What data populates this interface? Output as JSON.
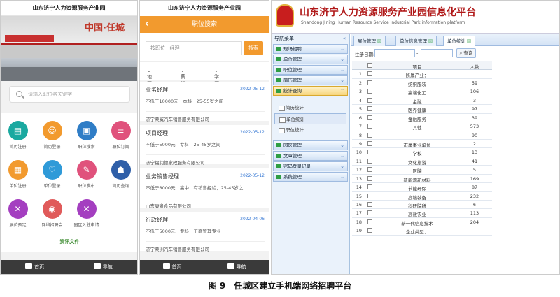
{
  "phone1": {
    "title": "山东济宁人力资源服务产业园",
    "banner_text": "中国·任城",
    "search_placeholder": "请输入职位名关键字",
    "grid": [
      {
        "label": "简历注册",
        "icon": "resume-register-icon",
        "color": "#1aa9a0"
      },
      {
        "label": "简历登录",
        "icon": "resume-login-icon",
        "color": "#f29a2e"
      },
      {
        "label": "职位搜索",
        "icon": "job-search-icon",
        "color": "#2f7dc6"
      },
      {
        "label": "职位订阅",
        "icon": "job-subscribe-icon",
        "color": "#e0527c"
      },
      {
        "label": "单位注册",
        "icon": "company-register-icon",
        "color": "#f29a2e"
      },
      {
        "label": "单位登录",
        "icon": "company-login-icon",
        "color": "#2f9ad8"
      },
      {
        "label": "职位发布",
        "icon": "job-publish-icon",
        "color": "#e0527c"
      },
      {
        "label": "简历查询",
        "icon": "resume-query-icon",
        "color": "#2f5fa8"
      },
      {
        "label": "展位预定",
        "icon": "booth-reserve-icon",
        "color": "#a43fc0"
      },
      {
        "label": "网络招聘会",
        "icon": "online-fair-icon",
        "color": "#e05a5a"
      },
      {
        "label": "园区入驻申请",
        "icon": "park-apply-icon",
        "color": "#a43fc0"
      }
    ],
    "section_label": "资讯文件",
    "tabbar": {
      "home": "首页",
      "nav": "导航"
    }
  },
  "phone2": {
    "title": "山东济宁人力资源服务产业园",
    "header": "职位搜索",
    "search_placeholder": "按职位 · 经理",
    "search_button": "搜索",
    "filters": {
      "area": "地区",
      "salary": "薪资",
      "education": "学历"
    },
    "jobs": [
      {
        "title": "业务经理",
        "date": "2022-05-12",
        "req": "不低于10000元　本科　25-55岁之间",
        "company": "济宁荣威汽车销售服务有限公司"
      },
      {
        "title": "项目经理",
        "date": "2022-05-12",
        "req": "不低于5000元　专科　25-45岁之间",
        "company": "济宁福润德家政服务有限公司"
      },
      {
        "title": "业务销售经理",
        "date": "2022-05-12",
        "req": "不低于8000元　高中　有销售经验，25-45岁之",
        "company": "山东康泉食品有限公司"
      },
      {
        "title": "行政经理",
        "date": "2022-04-06",
        "req": "不低于5000元　专科　工商管理专业",
        "company": "济宁荣洲汽车销售服务有限公司"
      }
    ],
    "tabbar": {
      "home": "首页",
      "nav": "导航"
    }
  },
  "web": {
    "title": "山东济宁人力资源服务产业园信息化平台",
    "subtitle": "Shandong Jining Human Resource Service Industrial Park information platform",
    "nav_title": "导航菜单",
    "menus_top": [
      "现场招聘",
      "单位管理",
      "职位管理",
      "简历管理"
    ],
    "menu_open": "统计查询",
    "submenus": [
      {
        "label": "简历统计",
        "selected": false
      },
      {
        "label": "单位统计",
        "selected": true
      },
      {
        "label": "职位统计",
        "selected": false
      }
    ],
    "menus_bottom": [
      "园区管理",
      "文章管理",
      "密码登录记录",
      "系统管理"
    ],
    "tabs": [
      "展位管理",
      "单位信息管理",
      "单位统计"
    ],
    "date_label": "注册日期:",
    "date_sep": "-",
    "query_button": "查询",
    "table_headers": {
      "item": "项目",
      "count": "人数"
    },
    "rows": [
      {
        "n": "1",
        "name": "所属产业：",
        "value": ""
      },
      {
        "n": "2",
        "name": "纺织服装",
        "value": "59"
      },
      {
        "n": "3",
        "name": "高端化工",
        "value": "106"
      },
      {
        "n": "4",
        "name": "金融",
        "value": "3"
      },
      {
        "n": "5",
        "name": "医养健康",
        "value": "97"
      },
      {
        "n": "6",
        "name": "金融服务",
        "value": "39"
      },
      {
        "n": "7",
        "name": "其他",
        "value": "573"
      },
      {
        "n": "8",
        "name": "",
        "value": "90"
      },
      {
        "n": "9",
        "name": "市属事业单位",
        "value": "2"
      },
      {
        "n": "10",
        "name": "学校",
        "value": "13"
      },
      {
        "n": "11",
        "name": "文化旅游",
        "value": "41"
      },
      {
        "n": "12",
        "name": "医院",
        "value": "5"
      },
      {
        "n": "13",
        "name": "新能源新材料",
        "value": "169"
      },
      {
        "n": "14",
        "name": "节能环保",
        "value": "87"
      },
      {
        "n": "15",
        "name": "高端装备",
        "value": "232"
      },
      {
        "n": "16",
        "name": "科研院所",
        "value": "6"
      },
      {
        "n": "17",
        "name": "高效农业",
        "value": "113"
      },
      {
        "n": "18",
        "name": "新一代信息技术",
        "value": "204"
      },
      {
        "n": "19",
        "name": "企业类型：",
        "value": ""
      }
    ]
  },
  "caption": "图 9　任城区建立手机端网络招聘平台"
}
